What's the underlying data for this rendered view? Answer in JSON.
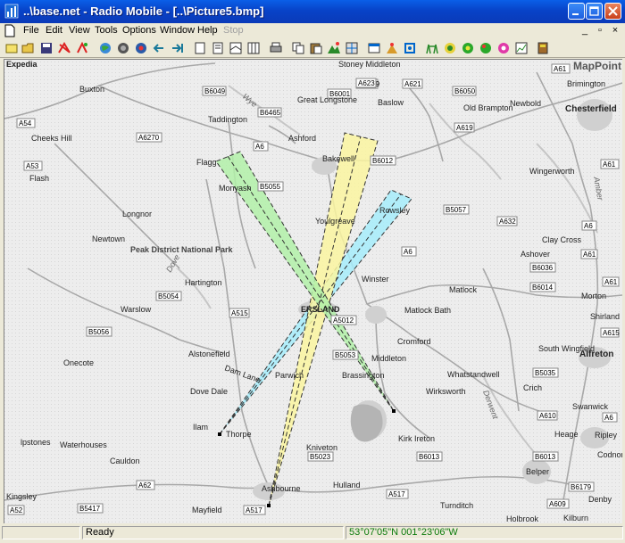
{
  "window": {
    "title": "..\\base.net - Radio Mobile - [..\\Picture5.bmp]"
  },
  "menu": {
    "items": [
      "File",
      "Edit",
      "View",
      "Tools",
      "Options",
      "Window",
      "Help",
      "Stop"
    ]
  },
  "toolbar_icons": [
    "new-icon",
    "open-icon",
    "save-icon",
    "network-icon",
    "units-icon",
    "globe-icon",
    "map-properties-icon",
    "map-extract-icon",
    "back-arrow-icon",
    "forward-arrow-icon",
    "print-icon",
    "copy-icon",
    "paste-icon",
    "elevation-icon",
    "merge-icon",
    "map-window-icon",
    "style-icon",
    "fit-icon",
    "radio-link-icon",
    "coverage-icon",
    "green-globe-icon",
    "green-globe-2-icon",
    "polar-icon",
    "pink-globe-icon",
    "cartesian-icon",
    "book-icon"
  ],
  "map": {
    "brand": "MapPoint",
    "place_labels": [
      "Expedia",
      "Buxton",
      "Taddington",
      "Great Longstone",
      "Stoney Middleton",
      "Baslow",
      "Brimington",
      "Chesterfield",
      "Old Brampton",
      "Newbold",
      "Ashford",
      "Cheeks Hill",
      "Flash",
      "Flagg",
      "Monyash",
      "Bakewell",
      "Rowsley",
      "Wingerworth",
      "Longnor",
      "Youlgreave",
      "Newtown",
      "Peak District National Park",
      "Clay Cross",
      "Ashover",
      "Hartington",
      "Winster",
      "Matlock",
      "Morton",
      "Warslow",
      "ERSLAND",
      "Matlock Bath",
      "Shirland",
      "Cromford",
      "Alstonefield",
      "South Wingfield",
      "Alfreton",
      "Onecote",
      "Middleton",
      "Dam Lane",
      "Parwich",
      "Brassington",
      "Whatstandwell",
      "Crich",
      "Dove Dale",
      "Wirksworth",
      "Swanwick",
      "Ilam",
      "Thorpe",
      "Kirk Ireton",
      "Heage",
      "Ripley",
      "lpstones",
      "Waterhouses",
      "Kniveton",
      "Codnor",
      "Cauldon",
      "Belper",
      "Ashbourne",
      "Hulland",
      "Denby",
      "Kingsley",
      "Turnditch",
      "Mayfield",
      "Holbrook",
      "Kilburn",
      "Wye",
      "Dove",
      "Derwent",
      "Amber"
    ],
    "road_labels": [
      "A53",
      "B6049",
      "B6465",
      "B6001",
      "A623",
      "A621",
      "B6050",
      "A61",
      "A6",
      "A619",
      "A6270",
      "A54",
      "A53",
      "B6012",
      "A632",
      "A61",
      "B5055",
      "B5057",
      "A6",
      "B6036",
      "B6014",
      "B5054",
      "A515",
      "B5056",
      "A5012",
      "A61",
      "B5053",
      "A615",
      "B6013",
      "B5035",
      "A610",
      "B6013",
      "A517",
      "B6179",
      "A62",
      "A6",
      "A609",
      "B5417",
      "A52",
      "A517",
      "B5023",
      "A6",
      "A61"
    ],
    "antennas": [
      {
        "from_place": "Thorpe",
        "to_place": "Rowsley",
        "color": "#A6ECFA"
      },
      {
        "from_place": "Ashbourne",
        "to_place": "Bakewell",
        "color": "#FAF5A0"
      },
      {
        "from_place": "Kirk Ireton",
        "to_place": "Monyash",
        "color": "#B2F0A8"
      }
    ]
  },
  "status": {
    "ready": "Ready",
    "coords": "53°07'05\"N 001°23'06\"W"
  }
}
